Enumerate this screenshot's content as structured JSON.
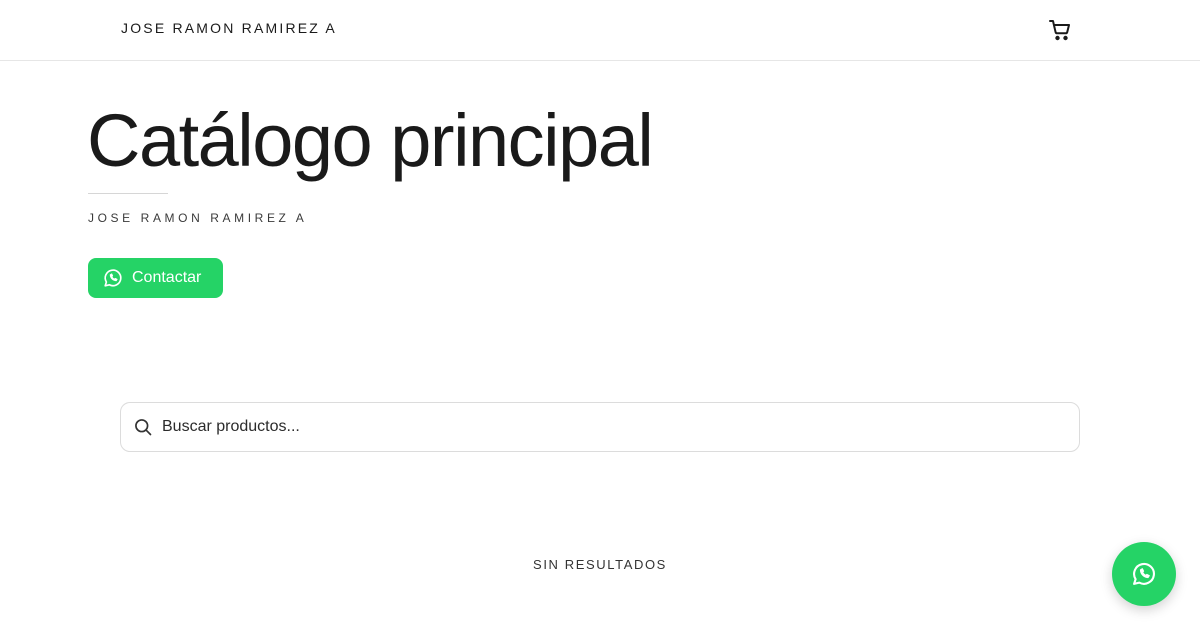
{
  "header": {
    "brand": "JOSE RAMON RAMIREZ A",
    "cart_icon": "cart-icon"
  },
  "hero": {
    "title": "Catálogo principal",
    "subtitle": "JOSE RAMON RAMIREZ A",
    "contact_label": "Contactar",
    "contact_icon": "whatsapp-icon"
  },
  "search": {
    "placeholder": "Buscar productos...",
    "value": "",
    "icon": "search-icon"
  },
  "results": {
    "empty_label": "SIN RESULTADOS"
  },
  "fab": {
    "icon": "whatsapp-icon"
  },
  "colors": {
    "accent": "#25d366",
    "text": "#1a1a1a",
    "border": "#dcdcdc"
  }
}
